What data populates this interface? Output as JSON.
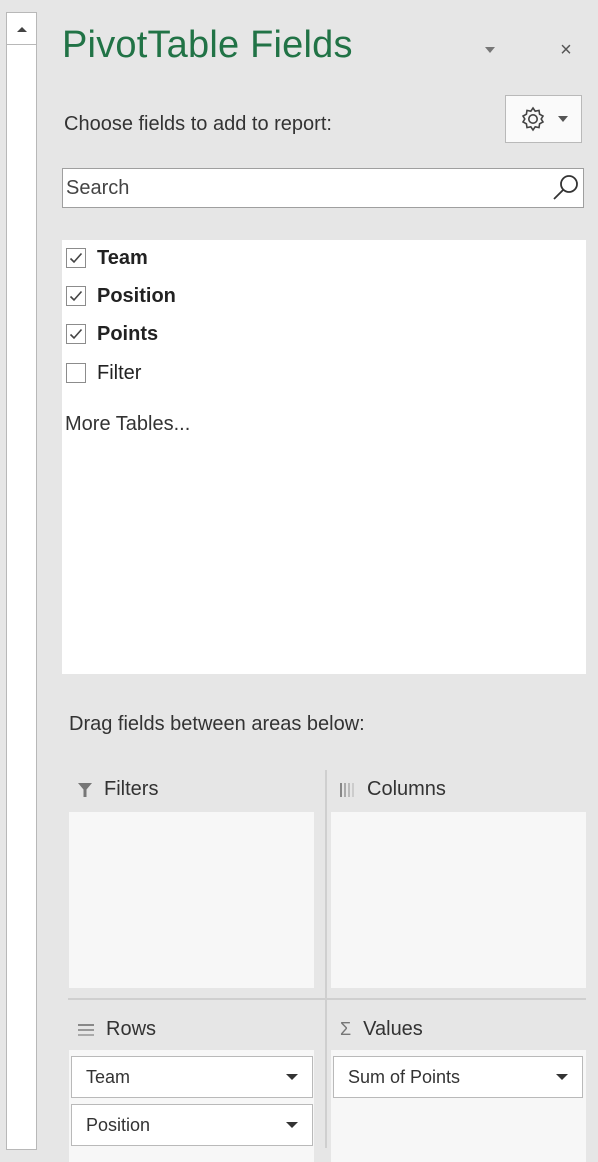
{
  "panel": {
    "title": "PivotTable Fields",
    "close_glyph": "×",
    "choose_label": "Choose fields to add to report:",
    "accent_color": "#217346"
  },
  "search": {
    "placeholder": "Search",
    "value": ""
  },
  "fields": [
    {
      "label": "Team",
      "checked": true
    },
    {
      "label": "Position",
      "checked": true
    },
    {
      "label": "Points",
      "checked": true
    },
    {
      "label": "Filter",
      "checked": false
    }
  ],
  "more_tables": "More Tables...",
  "areas": {
    "drag_label": "Drag fields between areas below:",
    "filters": {
      "label": "Filters",
      "icon": "filter-icon"
    },
    "columns": {
      "label": "Columns",
      "icon": "columns-icon"
    },
    "rows": {
      "label": "Rows",
      "icon": "rows-icon",
      "items": [
        "Team",
        "Position"
      ]
    },
    "values": {
      "label": "Values",
      "icon": "sigma-icon",
      "sigma": "Σ",
      "items": [
        "Sum of Points"
      ]
    }
  }
}
